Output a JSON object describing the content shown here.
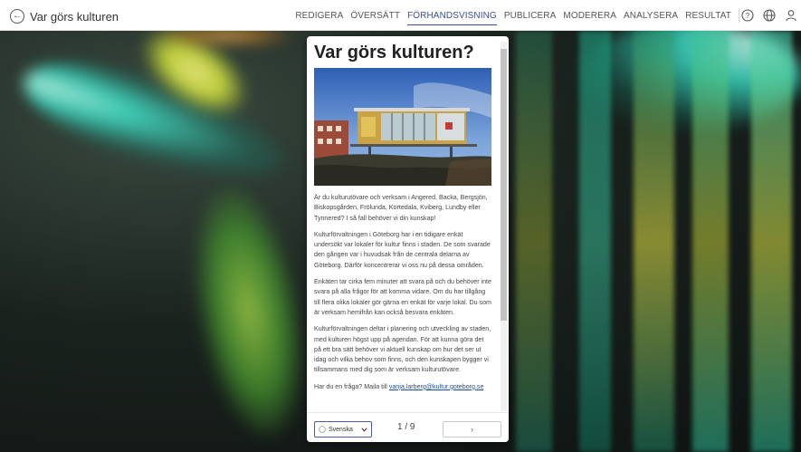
{
  "app": {
    "title": "Var görs kulturen"
  },
  "nav": {
    "items": [
      {
        "id": "redigera",
        "label": "REDIGERA"
      },
      {
        "id": "oversatt",
        "label": "ÖVERSÄTT"
      },
      {
        "id": "forhandsvisning",
        "label": "FÖRHANDSVISNING"
      },
      {
        "id": "publicera",
        "label": "PUBLICERA"
      },
      {
        "id": "moderera",
        "label": "MODERERA"
      },
      {
        "id": "analysera",
        "label": "ANALYSERA"
      },
      {
        "id": "resultat",
        "label": "RESULTAT"
      }
    ],
    "active": "forhandsvisning"
  },
  "icons": [
    "help-icon",
    "globe-icon",
    "user-icon"
  ],
  "preview": {
    "title": "Var görs kulturen?",
    "paragraphs": [
      "Är du kulturutövare och verksam i Angered, Backa, Bergsjön, Biskopsgården, Frölunda, Kortedala, Kviberg, Lundby eller Tynnered? I så fall behöver vi din kunskap!",
      "Kulturförvaltningen i Göteborg har i en tidigare enkät undersökt var lokaler för kultur finns i staden. De som svarade den gången var i huvudsak från de centrala delarna av Göteborg. Därför koncentrerar vi oss nu på dessa områden.",
      "Enkäten tar cirka fem minuter att svara på och du behöver inte svara på alla frågor för att komma vidare. Om du har tillgång till flera olika lokaler gör gärna en enkät för varje lokal. Du som är verksam hemifrån kan också besvara enkäten.",
      "Kulturförvaltningen deltar i planering och utveckling av staden, med kulturen högst upp på agendan. För att kunna göra det på ett bra sätt behöver vi aktuell kunskap om hur det ser ut idag och vilka behov som finns, och den kunskapen bygger vi tillsammans med dig som är verksam kulturutövare."
    ],
    "contact_prefix": "Har du en fråga? Maila till ",
    "contact_email": "vanja.larberg@kultur.goteborg.se",
    "language": "Svenska",
    "page_indicator": "1 / 9",
    "next_symbol": "›"
  }
}
